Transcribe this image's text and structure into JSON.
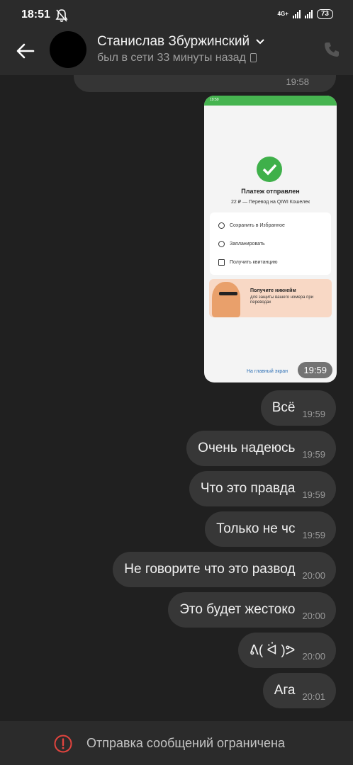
{
  "status_bar": {
    "time": "18:51",
    "network": "4G+",
    "battery": "73",
    "icons": [
      "bell-off-icon",
      "signal-icon",
      "battery-icon"
    ]
  },
  "header": {
    "contact_name": "Станислав Збуржинский",
    "last_seen": "был в сети 33 минуты назад",
    "icons": [
      "back-arrow-icon",
      "chevron-down-icon",
      "phone-device-icon",
      "call-icon"
    ]
  },
  "chat": {
    "previous_message_time": "19:58",
    "image_message": {
      "time": "19:59",
      "screenshot": {
        "status_time": "19:59",
        "title": "Платеж отправлен",
        "subtitle": "22 ₽ — Перевод на QIWI Кошелек",
        "actions": [
          "Сохранить в Избранное",
          "Запланировать",
          "Получить квитанцию"
        ],
        "promo_title": "Получите никнейм",
        "promo_text": "для защиты вашего номера при переводах",
        "link": "На главный экран"
      }
    },
    "messages": [
      {
        "text": "Всё",
        "time": "19:59"
      },
      {
        "text": "Очень надеюсь",
        "time": "19:59"
      },
      {
        "text": "Что это правда",
        "time": "19:59"
      },
      {
        "text": "Только не чс",
        "time": "19:59"
      },
      {
        "text": "Не говорите что это развод",
        "time": "20:00"
      },
      {
        "text": "Это будет жестоко",
        "time": "20:00"
      },
      {
        "text": "ᕕ( ᐛ )ᕗ",
        "time": "20:00"
      },
      {
        "text": "Ага",
        "time": "20:01"
      }
    ]
  },
  "bottom_bar": {
    "text": "Отправка сообщений ограничена",
    "icon": "warning-circle-icon",
    "accent_color": "#e0443e"
  },
  "colors": {
    "background": "#202020",
    "bar": "#2b2b2b",
    "bubble": "#373737"
  }
}
